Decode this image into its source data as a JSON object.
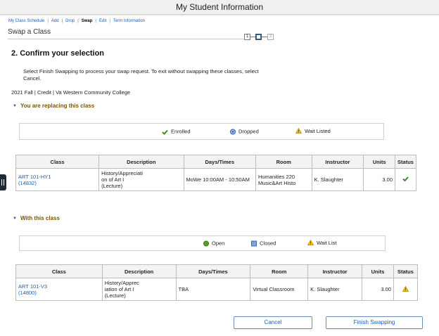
{
  "header": {
    "title": "My Student Information"
  },
  "nav": {
    "links": [
      "My Class Schedule",
      "Add",
      "Drop",
      "Swap",
      "Edit",
      "Term Information"
    ],
    "current": "Swap"
  },
  "page": {
    "title": "Swap a Class"
  },
  "steps": {
    "labels": [
      "1",
      "2",
      "3"
    ],
    "current": 2
  },
  "confirm": {
    "heading": "2.  Confirm your selection",
    "instructions": "Select Finish Swapping to process your swap request. To exit without swapping these classes, select Cancel.",
    "term": "2021 Fall | Credit | Va Western Community College"
  },
  "replacing": {
    "title": "You are replacing this class",
    "legend": [
      {
        "icon": "check-icon",
        "label": "Enrolled"
      },
      {
        "icon": "dropped-icon",
        "label": "Dropped"
      },
      {
        "icon": "warning-icon",
        "label": "Wait Listed"
      }
    ],
    "columns": [
      "Class",
      "Description",
      "Days/Times",
      "Room",
      "Instructor",
      "Units",
      "Status"
    ],
    "rows": [
      {
        "class_code": "ART 101-HY1",
        "class_number": "(14832)",
        "description": [
          "History/Appreciati",
          "on of Art I",
          "(Lecture)"
        ],
        "days_times": "MoWe 10:00AM - 10:50AM",
        "room": [
          "Humanities 220",
          "Music&Art Histo"
        ],
        "instructor": "K. Slaughter",
        "units": "3.00",
        "status_icon": "check-icon"
      }
    ]
  },
  "with": {
    "title": "With this class",
    "legend": [
      {
        "icon": "open-icon",
        "label": "Open"
      },
      {
        "icon": "closed-icon",
        "label": "Closed"
      },
      {
        "icon": "warning-icon",
        "label": "Wait List"
      }
    ],
    "columns": [
      "Class",
      "Description",
      "Days/Times",
      "Room",
      "Instructor",
      "Units",
      "Status"
    ],
    "rows": [
      {
        "class_code": "ART 101-V3",
        "class_number": "(14800)",
        "description": [
          "History/Apprec",
          "iation of Art I",
          "(Lecture)"
        ],
        "days_times": "TBA",
        "room": [
          "Virtual Classroom"
        ],
        "instructor": "K. Slaughter",
        "units": "3.00",
        "status_icon": "warning-icon"
      }
    ]
  },
  "buttons": {
    "cancel": "Cancel",
    "finish": "Finish Swapping"
  },
  "colors": {
    "link": "#1f5fa8",
    "section_title": "#7a5500",
    "check": "#3c8d1c",
    "warning": "#f2c200"
  }
}
